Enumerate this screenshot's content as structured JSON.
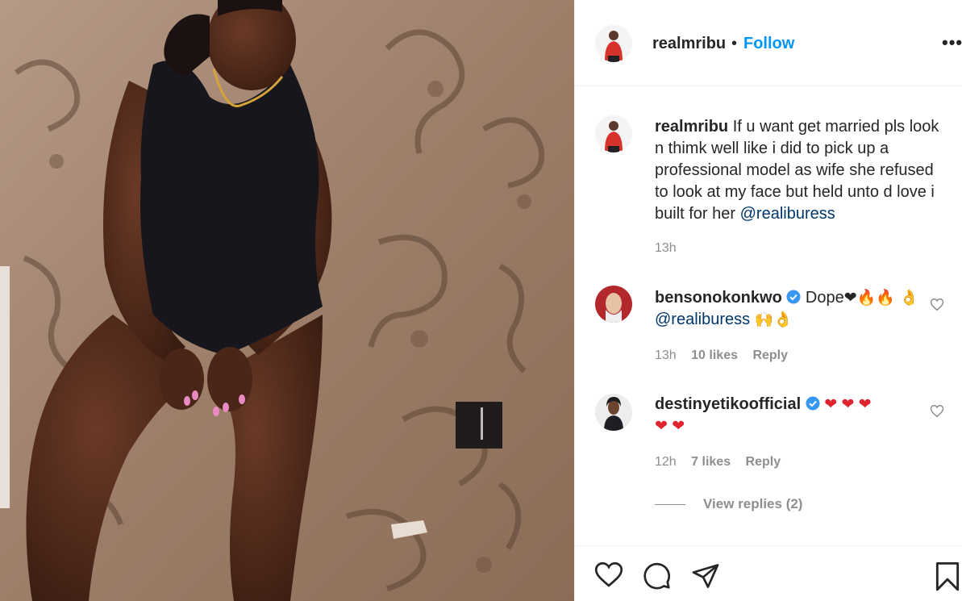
{
  "post": {
    "username": "realmribu",
    "dot": "•",
    "follow_label": "Follow",
    "more_label": "•••"
  },
  "caption": {
    "username": "realmribu",
    "text": "If u want get married pls look n thimk well like i did to pick up a professional model as wife she refused to look at my face but held unto d love i built for her",
    "mention": "@realiburess",
    "time": "13h"
  },
  "comments": [
    {
      "username": "bensonokonkwo",
      "text_before": "Dope",
      "emoji_line1": "❤🔥🔥",
      "emoji_start": "👌",
      "mention": "@realiburess",
      "emoji_end": "🙌👌",
      "time": "13h",
      "likes": "10 likes",
      "reply_label": "Reply"
    },
    {
      "username": "destinyetikoofficial",
      "emoji_line1": "❤ ❤ ❤",
      "emoji_line2": "❤ ❤",
      "time": "12h",
      "likes": "7 likes",
      "reply_label": "Reply"
    }
  ],
  "view_replies": "View replies (2)",
  "colors": {
    "accent": "#0095f6",
    "mention": "#00376b",
    "muted": "#8e8e8e",
    "verified": "#3897f0",
    "heart": "#ed4956"
  },
  "icons": [
    "heart-icon",
    "comment-icon",
    "share-icon",
    "bookmark-icon",
    "more-icon",
    "verified-badge-icon"
  ]
}
